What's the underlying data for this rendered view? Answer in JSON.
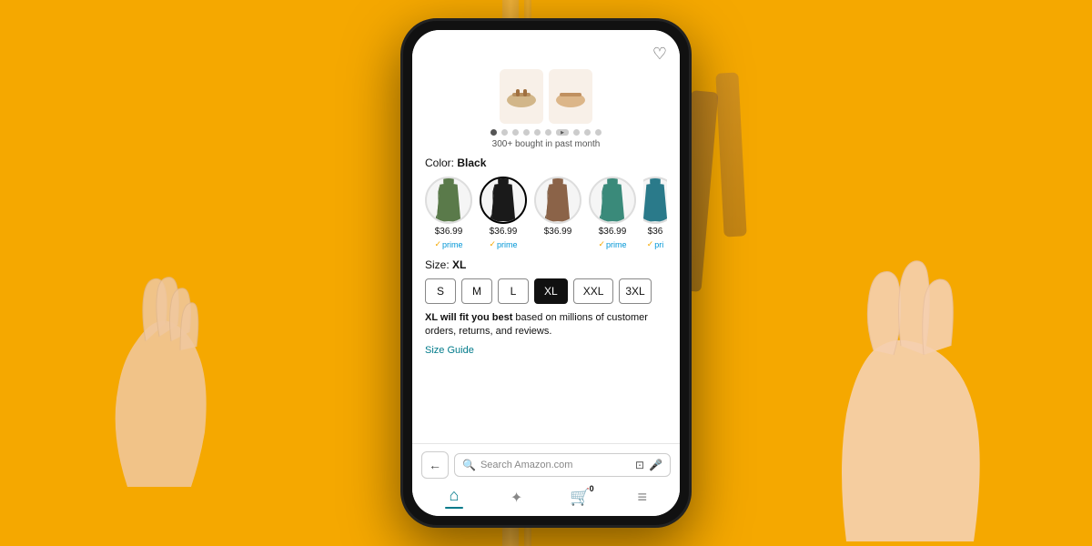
{
  "background": {
    "color": "#F5A800"
  },
  "phone": {
    "screen": {
      "wishlist_icon": "♡",
      "bought_badge": "300+ bought in past month",
      "carousel_dots": [
        "active",
        "inactive",
        "inactive",
        "inactive",
        "inactive",
        "inactive",
        "play",
        "inactive",
        "inactive",
        "inactive"
      ],
      "color_section": {
        "label": "Color:",
        "selected_color": "Black",
        "swatches": [
          {
            "color": "green",
            "price": "$36.99",
            "prime": true,
            "selected": false
          },
          {
            "color": "black",
            "price": "$36.99",
            "prime": true,
            "selected": true
          },
          {
            "color": "brown",
            "price": "$36.99",
            "prime": false,
            "selected": false
          },
          {
            "color": "teal",
            "price": "$36.99",
            "prime": true,
            "selected": false
          },
          {
            "color": "teal2",
            "price": "$36",
            "prime": true,
            "selected": false
          }
        ]
      },
      "size_section": {
        "label": "Size:",
        "selected_size": "XL",
        "sizes": [
          "S",
          "M",
          "L",
          "XL",
          "XXL",
          "3XL"
        ]
      },
      "fit_text": "XL will fit you best based on millions of customer orders, returns, and reviews.",
      "size_guide_label": "Size Guide"
    },
    "bottom_bar": {
      "back_arrow": "←",
      "search_placeholder": "Search Amazon.com",
      "camera_icon": "⊡",
      "mic_icon": "🎤",
      "nav_tabs": [
        {
          "id": "home",
          "icon": "⌂",
          "label": "home",
          "active": true
        },
        {
          "id": "ai",
          "icon": "✦",
          "label": "ai",
          "active": false
        },
        {
          "id": "cart",
          "icon": "🛒",
          "label": "cart",
          "count": "0",
          "active": false
        },
        {
          "id": "menu",
          "icon": "≡",
          "label": "menu",
          "active": false
        }
      ]
    }
  }
}
